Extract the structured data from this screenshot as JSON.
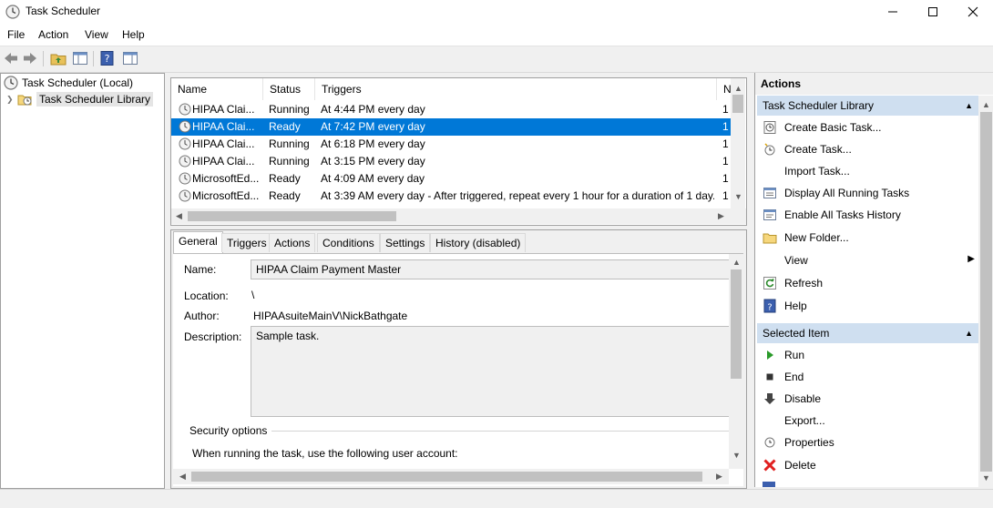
{
  "window": {
    "title": "Task Scheduler"
  },
  "menu": [
    "File",
    "Action",
    "View",
    "Help"
  ],
  "tree": {
    "root": "Task Scheduler (Local)",
    "library": "Task Scheduler Library"
  },
  "tasklist": {
    "columns": [
      "Name",
      "Status",
      "Triggers",
      "N"
    ],
    "rows": [
      {
        "name": "HIPAA Clai...",
        "status": "Running",
        "trigger": "At 4:44 PM every day",
        "next": "1"
      },
      {
        "name": "HIPAA Clai...",
        "status": "Ready",
        "trigger": "At 7:42 PM every day",
        "next": "1"
      },
      {
        "name": "HIPAA Clai...",
        "status": "Running",
        "trigger": "At 6:18 PM every day",
        "next": "1"
      },
      {
        "name": "HIPAA Clai...",
        "status": "Running",
        "trigger": "At 3:15 PM every day",
        "next": "1"
      },
      {
        "name": "MicrosoftEd...",
        "status": "Ready",
        "trigger": "At 4:09 AM every day",
        "next": "1"
      },
      {
        "name": "MicrosoftEd...",
        "status": "Ready",
        "trigger": "At 3:39 AM every day - After triggered, repeat every 1 hour for a duration of 1 day.",
        "next": "1"
      }
    ],
    "selected_index": 1
  },
  "tabs": [
    "General",
    "Triggers",
    "Actions",
    "Conditions",
    "Settings",
    "History (disabled)"
  ],
  "general": {
    "name_label": "Name:",
    "name_value": "HIPAA Claim Payment Master",
    "location_label": "Location:",
    "location_value": "\\",
    "author_label": "Author:",
    "author_value": "HIPAAsuiteMainV\\NickBathgate",
    "description_label": "Description:",
    "description_value": "Sample task.",
    "security_title": "Security options",
    "security_text": "When running the task, use the following user account:"
  },
  "actions_pane": {
    "title": "Actions",
    "library_section": "Task Scheduler Library",
    "library_items": [
      {
        "label": "Create Basic Task...",
        "icon": "create-basic-task-icon"
      },
      {
        "label": "Create Task...",
        "icon": "create-task-icon"
      },
      {
        "label": "Import Task...",
        "icon": ""
      },
      {
        "label": "Display All Running Tasks",
        "icon": "running-tasks-icon"
      },
      {
        "label": "Enable All Tasks History",
        "icon": "history-icon"
      },
      {
        "label": "New Folder...",
        "icon": "folder-icon"
      },
      {
        "label": "View",
        "icon": ""
      },
      {
        "label": "Refresh",
        "icon": "refresh-icon"
      },
      {
        "label": "Help",
        "icon": "help-icon"
      }
    ],
    "selected_section": "Selected Item",
    "selected_items": [
      {
        "label": "Run",
        "icon": "run-icon"
      },
      {
        "label": "End",
        "icon": "end-icon"
      },
      {
        "label": "Disable",
        "icon": "disable-icon"
      },
      {
        "label": "Export...",
        "icon": ""
      },
      {
        "label": "Properties",
        "icon": "properties-icon"
      },
      {
        "label": "Delete",
        "icon": "delete-icon"
      }
    ]
  },
  "colors": {
    "selection": "#0078d7",
    "section_header": "#cfdff0"
  }
}
